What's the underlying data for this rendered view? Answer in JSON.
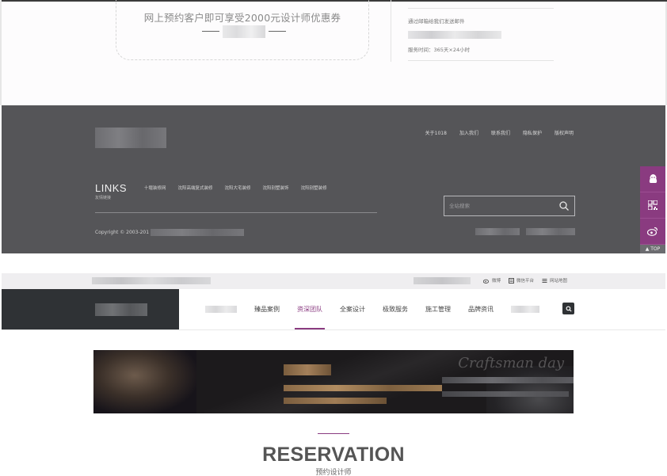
{
  "coupon": {
    "text": "网上预约客户即可享受2000元设计师优惠券"
  },
  "contact": {
    "mail_text": "通过邮箱给我们发送邮件",
    "service_hours": "服务时间：365天×24小时"
  },
  "footer": {
    "nav": [
      "关于1018",
      "加入我们",
      "联系我们",
      "隐私保护",
      "版权声明"
    ],
    "links_title": "LINKS",
    "links_subtitle": "友情链接",
    "links": [
      "十堰装修网",
      "沈阳高端复式装修",
      "沈阳大宅装修",
      "沈阳别墅装饰",
      "沈阳别墅装修"
    ],
    "search_placeholder": "全站搜索",
    "copyright": "Copyright © 2003-201"
  },
  "sidebar": {
    "icons": [
      "qq-icon",
      "qrcode-icon",
      "weibo-icon"
    ],
    "top_label": "▲ TOP"
  },
  "topbar": {
    "links": [
      "微博",
      "微信平台",
      "网站地图"
    ]
  },
  "nav": {
    "items": [
      "臻品案例",
      "资深团队",
      "全案设计",
      "极致服务",
      "施工管理",
      "品牌资讯"
    ],
    "active": "资深团队"
  },
  "banner": {
    "script_text": "Craftsman day"
  },
  "reservation": {
    "title": "RESERVATION",
    "subtitle": "预约设计师"
  },
  "colors": {
    "accent": "#8a3b80",
    "footer_bg": "#555558",
    "brand_bg": "#2f3235"
  }
}
